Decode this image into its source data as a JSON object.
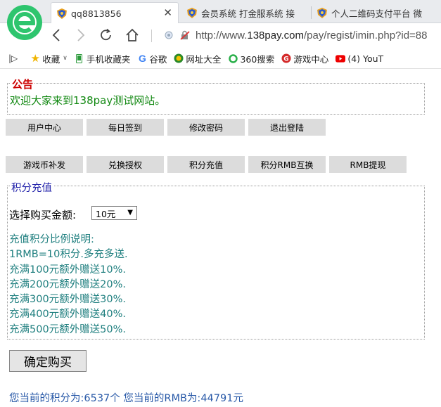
{
  "browser": {
    "tabs": [
      {
        "title": "qq8813856",
        "active": true
      },
      {
        "title": "会员系统 打金服系统 接",
        "active": false
      },
      {
        "title": "个人二维码支付平台 微",
        "active": false
      }
    ],
    "url_prefix": "http://www.",
    "url_host": "138pay.com",
    "url_path": "/pay/regist/imin.php?id=88",
    "bookmarks": [
      {
        "label": "收藏",
        "icon": "star-icon"
      },
      {
        "label": "手机收藏夹",
        "icon": "phone-icon"
      },
      {
        "label": "谷歌",
        "icon": "google-icon"
      },
      {
        "label": "网址大全",
        "icon": "sites-icon"
      },
      {
        "label": "360搜索",
        "icon": "search-360-icon"
      },
      {
        "label": "游戏中心",
        "icon": "game-icon"
      },
      {
        "label": "(4) YouT",
        "icon": "youtube-icon"
      }
    ]
  },
  "notice": {
    "title": "公告",
    "text": "欢迎大家来到138pay测试网站。"
  },
  "nav_row1": [
    "用户中心",
    "每日签到",
    "修改密码",
    "退出登陆"
  ],
  "nav_row2": [
    "游戏币补发",
    "兑换授权",
    "积分充值",
    "积分RMB互换",
    "RMB提现"
  ],
  "recharge": {
    "title": "积分充值",
    "amount_label": "选择购买金额:",
    "amount_selected": "10元",
    "ratio_lines": [
      "充值积分比例说明:",
      "1RMB=10积分.多充多送.",
      "充满100元额外赠送10%.",
      "充满200元额外赠送20%.",
      "充满300元额外赠送30%.",
      "充满400元额外赠送40%.",
      "充满500元额外赠送50%."
    ],
    "confirm_label": "确定购买"
  },
  "balance": {
    "text": "您当前的积分为:6537个 您当前的RMB为:44791元"
  },
  "colors": {
    "notice_title": "#cc0000",
    "notice_text": "#118811",
    "section_title": "#2222aa",
    "ratio_text": "#1f7f7f",
    "balance_text": "#2a5aa8",
    "nav_button_bg": "#dcdcdc"
  }
}
